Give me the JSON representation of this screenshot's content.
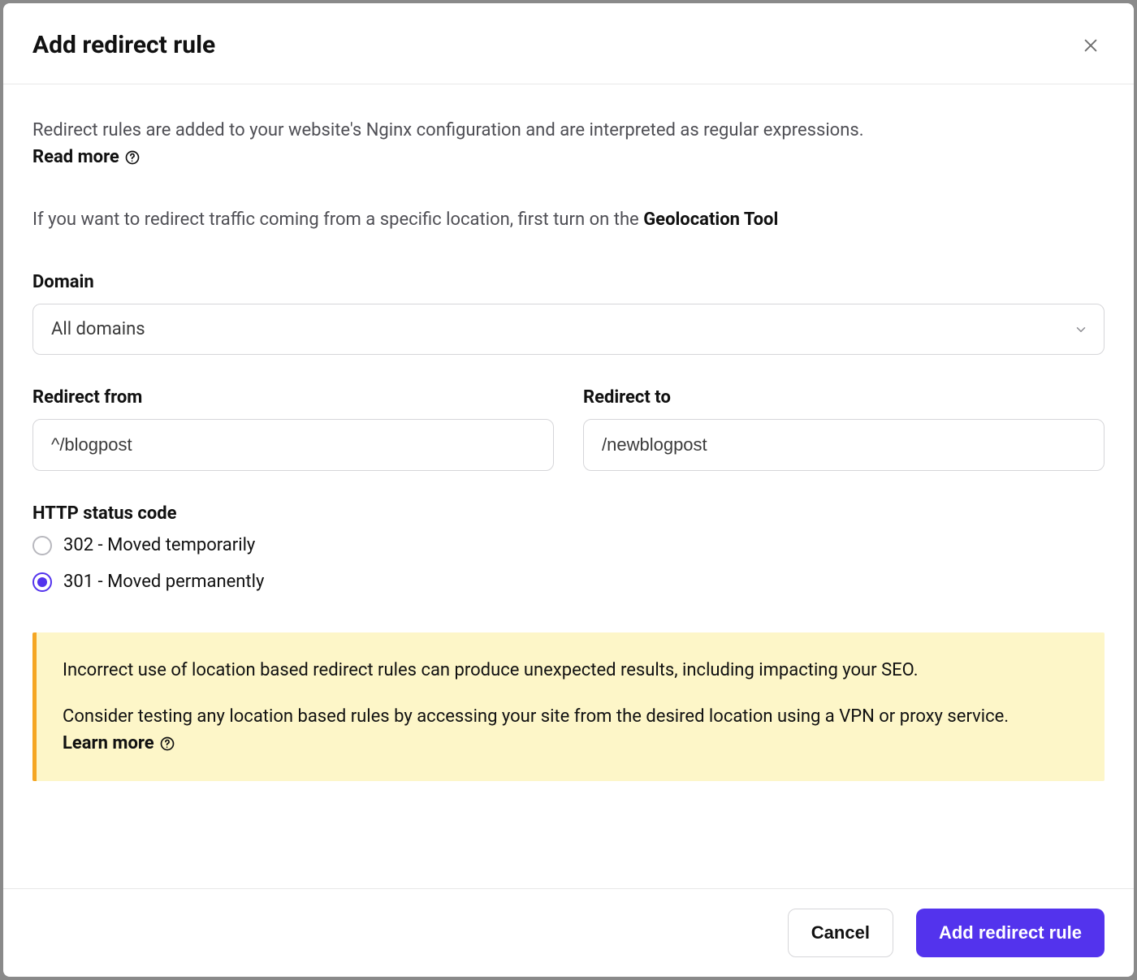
{
  "header": {
    "title": "Add redirect rule"
  },
  "intro": {
    "line1": "Redirect rules are added to your website's Nginx configuration and are interpreted as regular expressions.",
    "read_more_label": "Read more",
    "geo_prefix": "If you want to redirect traffic coming from a specific location, first turn on the ",
    "geo_link_label": "Geolocation Tool"
  },
  "fields": {
    "domain_label": "Domain",
    "domain_value": "All domains",
    "redirect_from_label": "Redirect from",
    "redirect_from_value": "^/blogpost",
    "redirect_to_label": "Redirect to",
    "redirect_to_value": "/newblogpost"
  },
  "status_code": {
    "label": "HTTP status code",
    "options": [
      {
        "label": "302 - Moved temporarily",
        "checked": false
      },
      {
        "label": "301 - Moved permanently",
        "checked": true
      }
    ]
  },
  "warning": {
    "line1": "Incorrect use of location based redirect rules can produce unexpected results, including impacting your SEO.",
    "line2_prefix": "Consider testing any location based rules by accessing your site from the desired location using a VPN or proxy service. ",
    "learn_more_label": "Learn more"
  },
  "footer": {
    "cancel_label": "Cancel",
    "submit_label": "Add redirect rule"
  }
}
